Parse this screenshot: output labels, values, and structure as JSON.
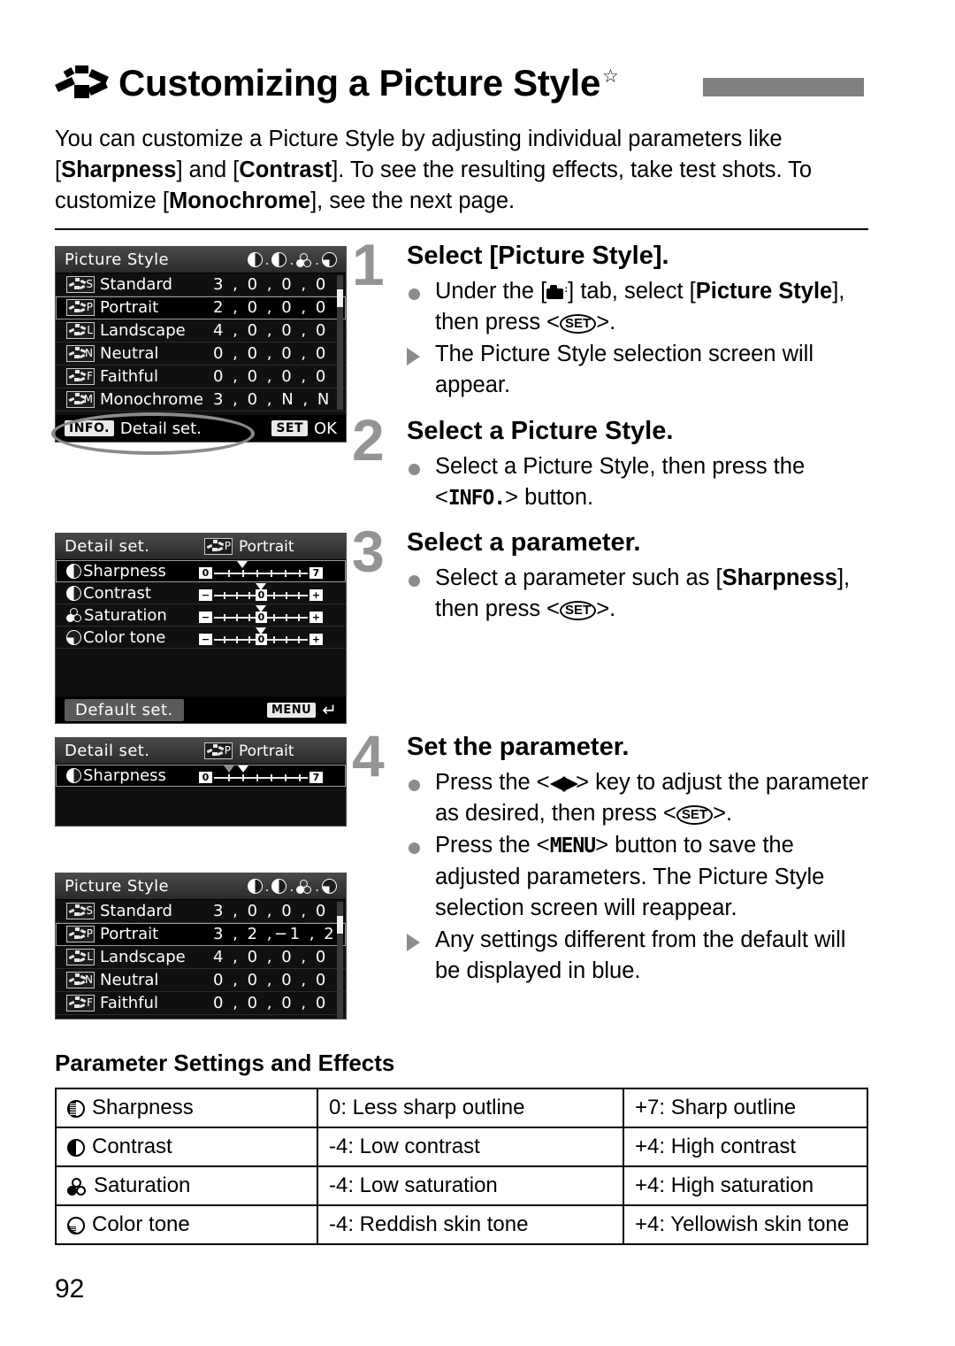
{
  "header": {
    "icon": "picture-style-burst-icon",
    "title": "Customizing a Picture Style",
    "star": "☆"
  },
  "intro": {
    "line1_a": "You can customize a Picture Style by adjusting individual parameters like [",
    "b1": "Sharpness",
    "line1_b": "] and [",
    "b2": "Contrast",
    "line1_c": "]. To see the resulting effects, take test shots. To customize [",
    "b3": "Monochrome",
    "line1_d": "], see the next page."
  },
  "screens": {
    "picture_style_before": {
      "header_title": "Picture Style",
      "header_icons": "◑ . ◑ . ☸ . ◔",
      "rows": [
        {
          "code": "S",
          "label": "Standard",
          "value": "3 , 0 , 0 , 0",
          "selected": false
        },
        {
          "code": "P",
          "label": "Portrait",
          "value": "2 , 0 , 0 , 0",
          "selected": true
        },
        {
          "code": "L",
          "label": "Landscape",
          "value": "4 , 0 , 0 , 0",
          "selected": false
        },
        {
          "code": "N",
          "label": "Neutral",
          "value": "0 , 0 , 0 , 0",
          "selected": false
        },
        {
          "code": "F",
          "label": "Faithful",
          "value": "0 , 0 , 0 , 0",
          "selected": false
        },
        {
          "code": "M",
          "label": "Monochrome",
          "value": "3 , 0 , N , N",
          "selected": false
        }
      ],
      "footer_left_key": "INFO.",
      "footer_left_label": "Detail set.",
      "footer_right_key": "SET",
      "footer_right_label": "OK"
    },
    "detail_set_full": {
      "header_title": "Detail set.",
      "header_style_code": "P",
      "header_style_label": "Portrait",
      "params": [
        {
          "name": "Sharpness",
          "icon": "sharpness-icon",
          "type": "zero-seven",
          "left": "0",
          "right": "7",
          "marker": 3,
          "selected": true
        },
        {
          "name": "Contrast",
          "icon": "contrast-icon",
          "type": "plus-minus",
          "left": "−",
          "right": "+",
          "zero": "0",
          "marker": 0,
          "selected": false
        },
        {
          "name": "Saturation",
          "icon": "saturation-icon",
          "type": "plus-minus",
          "left": "−",
          "right": "+",
          "zero": "0",
          "marker": 0,
          "selected": false
        },
        {
          "name": "Color tone",
          "icon": "color-tone-icon",
          "type": "plus-minus",
          "left": "−",
          "right": "+",
          "zero": "0",
          "marker": 0,
          "selected": false
        }
      ],
      "default_set_label": "Default set.",
      "menu_key": "MENU",
      "menu_glyph": "↵"
    },
    "detail_set_sharpness": {
      "header_title": "Detail set.",
      "header_style_code": "P",
      "header_style_label": "Portrait",
      "param": {
        "name": "Sharpness",
        "icon": "sharpness-icon",
        "left": "0",
        "right": "7",
        "marker_old": 2,
        "marker_new": 3
      }
    },
    "picture_style_after": {
      "header_title": "Picture Style",
      "header_icons": "◑ . ◑ . ☸ . ◔",
      "rows": [
        {
          "code": "S",
          "label": "Standard",
          "value": "3 , 0 , 0 , 0",
          "selected": false
        },
        {
          "code": "P",
          "label": "Portrait",
          "value": "3 , 2 ,−1 , 2",
          "selected": true
        },
        {
          "code": "L",
          "label": "Landscape",
          "value": "4 , 0 , 0 , 0",
          "selected": false
        },
        {
          "code": "N",
          "label": "Neutral",
          "value": "0 , 0 , 0 , 0",
          "selected": false
        },
        {
          "code": "F",
          "label": "Faithful",
          "value": "0 , 0 , 0 , 0",
          "selected": false
        }
      ]
    }
  },
  "steps": [
    {
      "num": "1",
      "head": "Select [Picture Style].",
      "bullets": [
        {
          "mark": "dot",
          "t1": "Under the [",
          "tab_icon": "camera-tab-icon",
          "t2": "] tab, select [",
          "b1": "Picture Style",
          "t3": "], then press <",
          "key": "SET",
          "t4": ">."
        },
        {
          "mark": "tri",
          "t1": "The Picture Style selection screen will appear."
        }
      ]
    },
    {
      "num": "2",
      "head": "Select a Picture Style.",
      "bullets": [
        {
          "mark": "dot",
          "t1": "Select a Picture Style, then press the <",
          "info": "INFO.",
          "t2": "> button."
        }
      ]
    },
    {
      "num": "3",
      "head": "Select a parameter.",
      "bullets": [
        {
          "mark": "dot",
          "t1": "Select a parameter such as [",
          "b1": "Sharpness",
          "t2": "], then press <",
          "key": "SET",
          "t3": ">."
        }
      ]
    },
    {
      "num": "4",
      "head": "Set the parameter.",
      "bullets": [
        {
          "mark": "dot",
          "t1": "Press the <",
          "arrow": "◀▶",
          "t2": "> key to adjust the parameter as desired, then press <",
          "key": "SET",
          "t3": ">."
        },
        {
          "mark": "dot",
          "t1": "Press the <",
          "menu": "MENU",
          "t2": "> button to save the adjusted parameters. The Picture Style selection screen will reappear."
        },
        {
          "mark": "tri",
          "t1": "Any settings different from the default will be displayed in blue."
        }
      ]
    }
  ],
  "table": {
    "title": "Parameter Settings and Effects",
    "rows": [
      {
        "icon": "sharpness-icon",
        "param": "Sharpness",
        "low": "0: Less sharp outline",
        "high": "+7: Sharp outline"
      },
      {
        "icon": "contrast-icon",
        "param": "Contrast",
        "low": "-4: Low contrast",
        "high": "+4: High contrast"
      },
      {
        "icon": "saturation-icon",
        "param": "Saturation",
        "low": "-4: Low saturation",
        "high": "+4: High saturation"
      },
      {
        "icon": "color-tone-icon",
        "param": "Color tone",
        "low": "-4: Reddish skin tone",
        "high": "+4: Yellowish skin tone"
      }
    ]
  },
  "page_number": "92",
  "colors": {
    "accent_gray": "#949494",
    "bar_gray": "#808080",
    "screen_bg": "#101010"
  }
}
